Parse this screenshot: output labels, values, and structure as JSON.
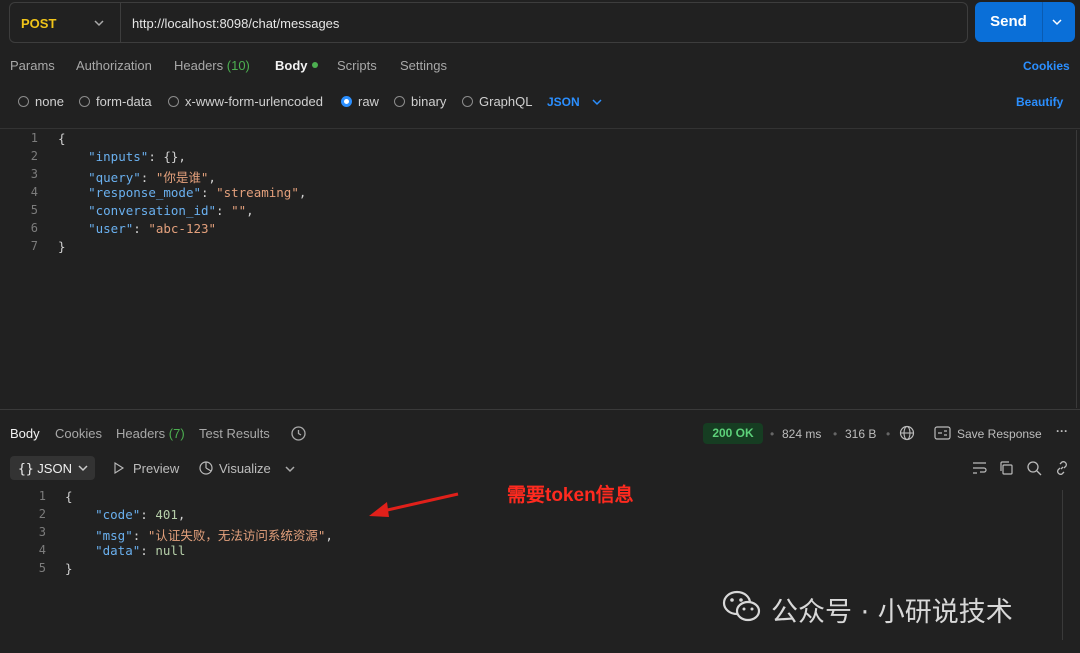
{
  "request": {
    "method": "POST",
    "url": "http://localhost:8098/chat/messages",
    "send_label": "Send"
  },
  "request_tabs": [
    {
      "label": "Params"
    },
    {
      "label": "Authorization"
    },
    {
      "label": "Headers",
      "count": "(10)"
    },
    {
      "label": "Body"
    },
    {
      "label": "Scripts"
    },
    {
      "label": "Settings"
    }
  ],
  "cookies_link": "Cookies",
  "body_types": [
    "none",
    "form-data",
    "x-www-form-urlencoded",
    "raw",
    "binary",
    "GraphQL"
  ],
  "body_format": "JSON",
  "beautify_link": "Beautify",
  "request_body": {
    "line_numbers": [
      "1",
      "2",
      "3",
      "4",
      "5",
      "6",
      "7"
    ],
    "lines": [
      [
        {
          "t": "{",
          "c": "p"
        }
      ],
      [
        {
          "t": "    ",
          "c": "p"
        },
        {
          "t": "\"inputs\"",
          "c": "k"
        },
        {
          "t": ": {},",
          "c": "p"
        }
      ],
      [
        {
          "t": "    ",
          "c": "p"
        },
        {
          "t": "\"query\"",
          "c": "k"
        },
        {
          "t": ": ",
          "c": "p"
        },
        {
          "t": "\"你是谁\"",
          "c": "s"
        },
        {
          "t": ",",
          "c": "p"
        }
      ],
      [
        {
          "t": "    ",
          "c": "p"
        },
        {
          "t": "\"response_mode\"",
          "c": "k"
        },
        {
          "t": ": ",
          "c": "p"
        },
        {
          "t": "\"streaming\"",
          "c": "s"
        },
        {
          "t": ",",
          "c": "p"
        }
      ],
      [
        {
          "t": "    ",
          "c": "p"
        },
        {
          "t": "\"conversation_id\"",
          "c": "k"
        },
        {
          "t": ": ",
          "c": "p"
        },
        {
          "t": "\"\"",
          "c": "s"
        },
        {
          "t": ",",
          "c": "p"
        }
      ],
      [
        {
          "t": "    ",
          "c": "p"
        },
        {
          "t": "\"user\"",
          "c": "k"
        },
        {
          "t": ": ",
          "c": "p"
        },
        {
          "t": "\"abc-123\"",
          "c": "s"
        }
      ],
      [
        {
          "t": "}",
          "c": "p"
        }
      ]
    ]
  },
  "response_tabs": [
    {
      "label": "Body"
    },
    {
      "label": "Cookies"
    },
    {
      "label": "Headers",
      "count": "(7)"
    },
    {
      "label": "Test Results"
    }
  ],
  "response_meta": {
    "status": "200 OK",
    "time": "824 ms",
    "size": "316 B",
    "save_label": "Save Response"
  },
  "response_view": {
    "format_label": "JSON",
    "preview_label": "Preview",
    "visualize_label": "Visualize"
  },
  "response_body": {
    "line_numbers": [
      "1",
      "2",
      "3",
      "4",
      "5"
    ],
    "lines": [
      [
        {
          "t": "{",
          "c": "p"
        }
      ],
      [
        {
          "t": "    ",
          "c": "p"
        },
        {
          "t": "\"code\"",
          "c": "k"
        },
        {
          "t": ": ",
          "c": "p"
        },
        {
          "t": "401",
          "c": "n"
        },
        {
          "t": ",",
          "c": "p"
        }
      ],
      [
        {
          "t": "    ",
          "c": "p"
        },
        {
          "t": "\"msg\"",
          "c": "k"
        },
        {
          "t": ": ",
          "c": "p"
        },
        {
          "t": "\"认证失败，无法访问系统资源\"",
          "c": "s"
        },
        {
          "t": ",",
          "c": "p"
        }
      ],
      [
        {
          "t": "    ",
          "c": "p"
        },
        {
          "t": "\"data\"",
          "c": "k"
        },
        {
          "t": ": ",
          "c": "p"
        },
        {
          "t": "null",
          "c": "n"
        }
      ],
      [
        {
          "t": "}",
          "c": "p"
        }
      ]
    ]
  },
  "annotation": "需要token信息",
  "watermark": "公众号 · 小研说技术",
  "colors": {
    "accent": "#0a6fd8",
    "method": "#f0c419",
    "annotation": "#ff2a1f",
    "status": "#5dd17a"
  }
}
